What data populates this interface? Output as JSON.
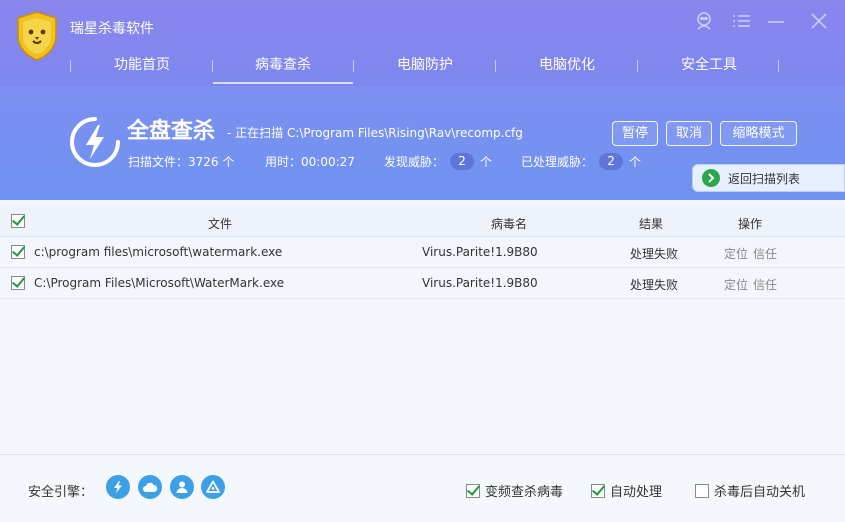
{
  "app": {
    "title": "瑞星杀毒软件"
  },
  "nav": {
    "tabs": [
      {
        "label": "功能首页",
        "active": false
      },
      {
        "label": "病毒查杀",
        "active": true
      },
      {
        "label": "电脑防护",
        "active": false
      },
      {
        "label": "电脑优化",
        "active": false
      },
      {
        "label": "安全工具",
        "active": false
      }
    ]
  },
  "scan": {
    "title": "全盘查杀",
    "status": "- 正在扫描 C:\\Program Files\\Rising\\Rav\\recomp.cfg",
    "files_label": "扫描文件：",
    "files_value": "3726 个",
    "time_label": "用时：",
    "time_value": "00:00:27",
    "threats_label": "发现威胁：",
    "threats_value": "2",
    "threats_unit": "个",
    "handled_label": "已处理威胁：",
    "handled_value": "2",
    "handled_unit": "个"
  },
  "buttons": {
    "pause": "暂停",
    "cancel": "取消",
    "mini": "缩略模式",
    "back": "返回扫描列表"
  },
  "table": {
    "headers": {
      "file": "文件",
      "virus": "病毒名",
      "result": "结果",
      "action": "操作"
    },
    "rows": [
      {
        "checked": true,
        "file": "c:\\program files\\microsoft\\watermark.exe",
        "virus": "Virus.Parite!1.9B80",
        "result": "处理失败",
        "locate": "定位",
        "trust": "信任"
      },
      {
        "checked": true,
        "file": "C:\\Program Files\\Microsoft\\WaterMark.exe",
        "virus": "Virus.Parite!1.9B80",
        "result": "处理失败",
        "locate": "定位",
        "trust": "信任"
      }
    ]
  },
  "footer": {
    "engine_label": "安全引擎：",
    "engines": [
      "lightning-icon",
      "cloud-icon",
      "user-icon",
      "triangle-icon"
    ],
    "options": [
      {
        "label": "变频查杀病毒",
        "checked": true
      },
      {
        "label": "自动处理",
        "checked": true
      },
      {
        "label": "杀毒后自动关机",
        "checked": false
      }
    ]
  },
  "colors": {
    "header": "#7c87ee",
    "accent": "#3ba0e6",
    "check": "#1e9b3c"
  }
}
